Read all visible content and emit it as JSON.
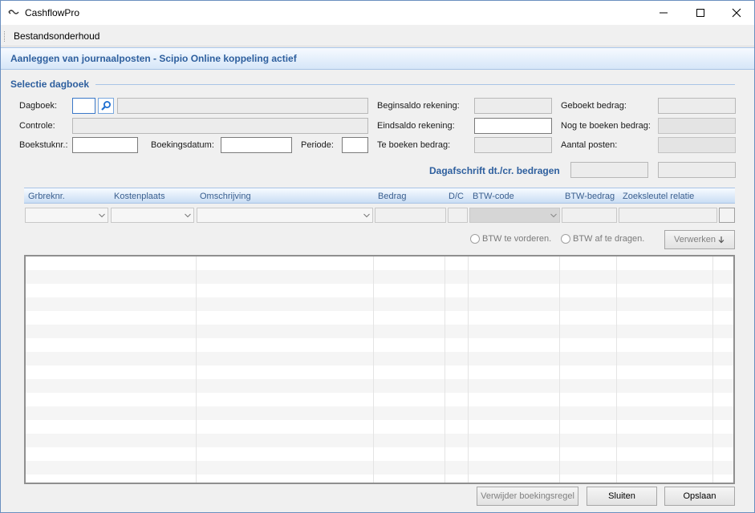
{
  "window": {
    "title": "CashflowPro",
    "controls": {
      "minimize": "minimize-icon",
      "maximize": "maximize-icon",
      "close": "close-icon"
    }
  },
  "menu": {
    "items": [
      {
        "label": "Bestandsonderhoud"
      }
    ]
  },
  "header": {
    "title": "Aanleggen van journaalposten - Scipio Online koppeling actief"
  },
  "selectie": {
    "title": "Selectie dagboek",
    "dagboek_label": "Dagboek:",
    "dagboek_value": "",
    "dagboek_name": "",
    "controle_label": "Controle:",
    "controle_value": "",
    "boekstuknr_label": "Boekstuknr.:",
    "boekstuknr_value": "",
    "boekingsdatum_label": "Boekingsdatum:",
    "boekingsdatum_value": "",
    "periode_label": "Periode:",
    "periode_value": "",
    "beginsaldo_label": "Beginsaldo rekening:",
    "beginsaldo_value": "",
    "eindsaldo_label": "Eindsaldo rekening:",
    "eindsaldo_value": "",
    "te_boeken_label": "Te boeken bedrag:",
    "te_boeken_value": "",
    "geboekt_label": "Geboekt bedrag:",
    "geboekt_value": "",
    "nog_te_boeken_label": "Nog te boeken bedrag:",
    "nog_te_boeken_value": "",
    "aantal_posten_label": "Aantal posten:",
    "aantal_posten_value": "",
    "dagafschrift_label": "Dagafschrift dt./cr. bedragen",
    "dagafschrift_dt": "",
    "dagafschrift_cr": ""
  },
  "grid": {
    "columns": [
      "Grbreknr.",
      "Kostenplaats",
      "Omschrijving",
      "Bedrag",
      "D/C",
      "BTW-code",
      "BTW-bedrag",
      "Zoeksleutel relatie"
    ],
    "rows": []
  },
  "options": {
    "btw_vorderen": "BTW te vorderen.",
    "btw_afdragen": "BTW af te dragen."
  },
  "buttons": {
    "verwerken": "Verwerken",
    "verwijder": "Verwijder boekingsregel",
    "sluiten": "Sluiten",
    "opslaan": "Opslaan"
  },
  "colors": {
    "accent": "#2e5f9e",
    "header_band": "#d6e6f8",
    "border": "#a9c4e6"
  }
}
